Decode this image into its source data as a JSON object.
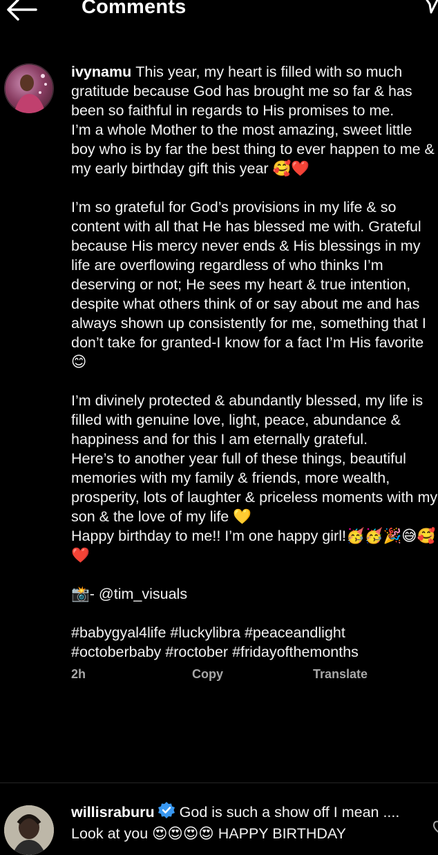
{
  "header": {
    "title": "Comments"
  },
  "caption": {
    "username": "ivynamu",
    "lines": [
      "This year, my heart is filled with so much gratitude because God has brought me so far & has been so faithful in regards to His promises to me.",
      "I’m a whole Mother to the most amazing, sweet little boy who is by far the best thing to ever happen to me & my early birthday gift this year 🥰❤️",
      "",
      "I’m so grateful for God’s provisions in my life & so content with all that He has blessed me with. Grateful because His mercy never ends & His blessings in my life are overflowing regardless of who thinks I’m deserving or not; He sees my heart & true intention, despite what others think of or say about me and has always shown up consistently for me, something that I don’t take for granted-I know for a fact I’m His favorite 😊",
      "",
      "I’m divinely protected & abundantly blessed, my life is filled with genuine love, light, peace, abundance & happiness and for this I am eternally grateful.",
      "Here’s to another year full of these things, beautiful memories with my family & friends, more wealth, prosperity, lots of laughter & priceless moments with my son & the love of my life 💛",
      "Happy birthday to me!! I’m one happy girl!🥳🥳🎉😅🥰❤️",
      "",
      "📸- @tim_visuals",
      "",
      "#babygyal4life #luckylibra #peaceandlight #octoberbaby #roctober #fridayofthemonths"
    ],
    "time": "2h",
    "copy_label": "Copy",
    "translate_label": "Translate"
  },
  "comment": {
    "username": "willisraburu",
    "text": "God is such a show off I mean .... Look at you 😍😍😍😍 HAPPY BIRTHDAY"
  },
  "colors": {
    "background": "#000000",
    "text": "#f5f5f5",
    "meta": "#a8a8a8",
    "verified": "#3897f0"
  },
  "icons": {
    "back": "arrow-left-icon",
    "send": "send-icon",
    "verified": "verified-badge-icon",
    "like": "heart-outline-icon"
  }
}
